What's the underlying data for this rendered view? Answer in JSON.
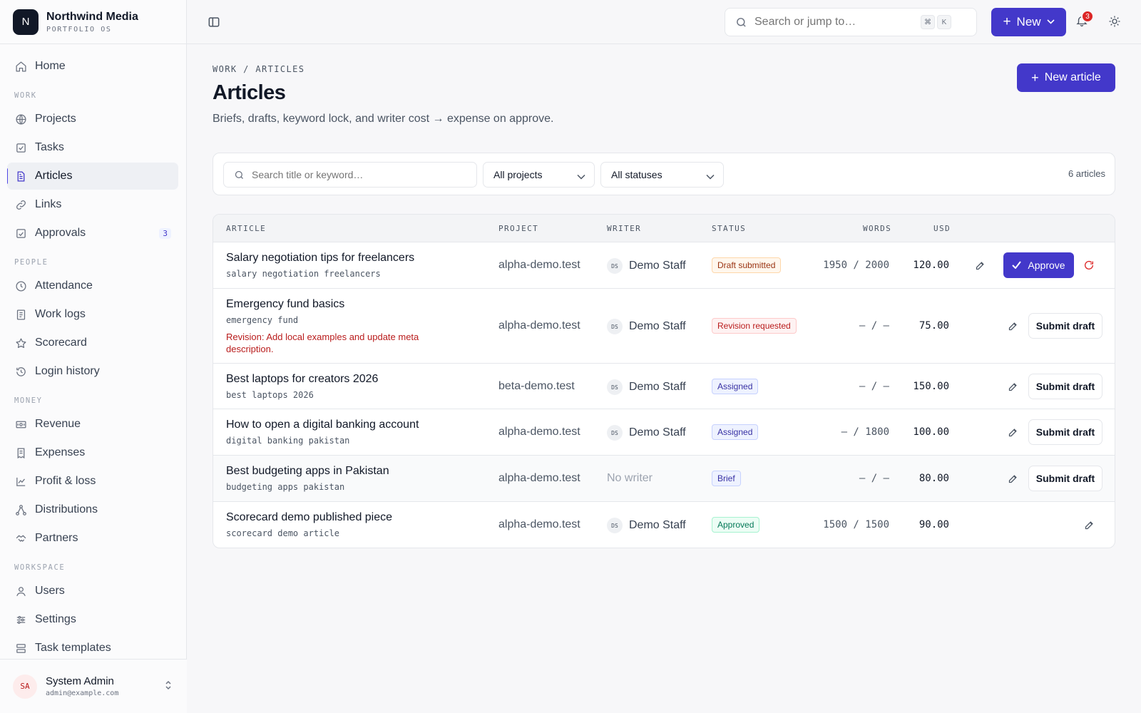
{
  "brand": {
    "logo_letter": "N",
    "name": "Northwind Media",
    "tagline": "PORTFOLIO OS"
  },
  "sidebar": {
    "home": {
      "label": "Home",
      "icon": "home-icon"
    },
    "sections": [
      {
        "title": "WORK",
        "items": [
          {
            "label": "Projects",
            "icon": "globe-icon"
          },
          {
            "label": "Tasks",
            "icon": "checkbox-icon"
          },
          {
            "label": "Articles",
            "icon": "document-icon",
            "active": true
          },
          {
            "label": "Links",
            "icon": "link-icon"
          },
          {
            "label": "Approvals",
            "icon": "approval-icon",
            "badge": "3"
          }
        ]
      },
      {
        "title": "PEOPLE",
        "items": [
          {
            "label": "Attendance",
            "icon": "clock-icon"
          },
          {
            "label": "Work logs",
            "icon": "notebook-icon"
          },
          {
            "label": "Scorecard",
            "icon": "star-icon"
          },
          {
            "label": "Login history",
            "icon": "history-icon"
          }
        ]
      },
      {
        "title": "MONEY",
        "items": [
          {
            "label": "Revenue",
            "icon": "banknote-icon"
          },
          {
            "label": "Expenses",
            "icon": "receipt-icon"
          },
          {
            "label": "Profit & loss",
            "icon": "chart-line-icon"
          },
          {
            "label": "Distributions",
            "icon": "network-icon"
          },
          {
            "label": "Partners",
            "icon": "handshake-icon"
          }
        ]
      },
      {
        "title": "WORKSPACE",
        "items": [
          {
            "label": "Users",
            "icon": "user-icon"
          },
          {
            "label": "Settings",
            "icon": "sliders-icon"
          },
          {
            "label": "Task templates",
            "icon": "template-icon"
          }
        ]
      }
    ]
  },
  "user": {
    "initials": "SA",
    "name": "System Admin",
    "email": "admin@example.com"
  },
  "topbar": {
    "search_placeholder": "Search or jump to…",
    "shortcut_keys": [
      "⌘",
      "K"
    ],
    "new_label": "New",
    "notification_count": "3"
  },
  "page": {
    "breadcrumb": "WORK / ARTICLES",
    "title": "Articles",
    "subtitle": "Briefs, drafts, keyword lock, and writer cost → expense on approve.",
    "new_article_label": "New article"
  },
  "filters": {
    "search_placeholder": "Search title or keyword…",
    "project_select": "All projects",
    "status_select": "All statuses",
    "count_label": "6 articles"
  },
  "table": {
    "headers": {
      "article": "ARTICLE",
      "project": "PROJECT",
      "writer": "WRITER",
      "status": "STATUS",
      "words": "WORDS",
      "usd": "USD"
    },
    "rows": [
      {
        "title": "Salary negotiation tips for freelancers",
        "keyword": "salary negotiation freelancers",
        "project": "alpha-demo.test",
        "writer_initials": "DS",
        "writer": "Demo Staff",
        "status": "Draft submitted",
        "status_kind": "draft",
        "words": "1950 / 2000",
        "usd": "120.00",
        "action": "Approve"
      },
      {
        "title": "Emergency fund basics",
        "keyword": "emergency fund",
        "revision_note": "Revision: Add local examples and update meta description.",
        "project": "alpha-demo.test",
        "writer_initials": "DS",
        "writer": "Demo Staff",
        "status": "Revision requested",
        "status_kind": "revision",
        "words": "– / –",
        "usd": "75.00",
        "action": "Submit draft"
      },
      {
        "title": "Best laptops for creators 2026",
        "keyword": "best laptops 2026",
        "project": "beta-demo.test",
        "writer_initials": "DS",
        "writer": "Demo Staff",
        "status": "Assigned",
        "status_kind": "assigned",
        "words": "– / –",
        "usd": "150.00",
        "action": "Submit draft"
      },
      {
        "title": "How to open a digital banking account",
        "keyword": "digital banking pakistan",
        "project": "alpha-demo.test",
        "writer_initials": "DS",
        "writer": "Demo Staff",
        "status": "Assigned",
        "status_kind": "assigned",
        "words": "– / 1800",
        "usd": "100.00",
        "action": "Submit draft"
      },
      {
        "title": "Best budgeting apps in Pakistan",
        "keyword": "budgeting apps pakistan",
        "project": "alpha-demo.test",
        "writer": "No writer",
        "status": "Brief",
        "status_kind": "brief",
        "words": "– / –",
        "usd": "80.00",
        "action": "Submit draft"
      },
      {
        "title": "Scorecard demo published piece",
        "keyword": "scorecard demo article",
        "project": "alpha-demo.test",
        "writer_initials": "DS",
        "writer": "Demo Staff",
        "status": "Approved",
        "status_kind": "approved",
        "words": "1500 / 1500",
        "usd": "90.00"
      }
    ]
  },
  "colors": {
    "accent": "#4338ca",
    "danger": "#dc2626"
  }
}
